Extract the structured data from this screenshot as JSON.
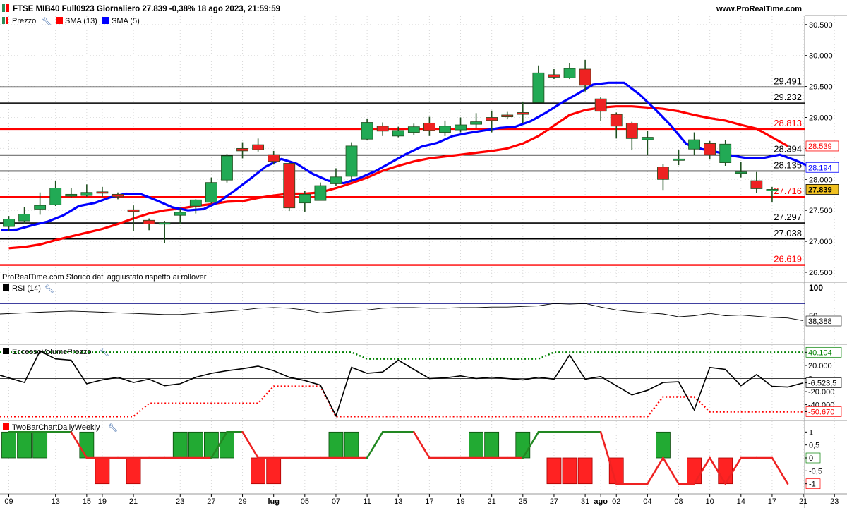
{
  "header": {
    "title": "FTSE MIB40 Full0923 Giornaliero 27.839 -0,38% 18 ago 2023, 21:59:59",
    "site": "www.ProRealTime.com"
  },
  "legend": [
    {
      "label": "Prezzo",
      "color": "#2e8b57"
    },
    {
      "label": "SMA (13)",
      "color": "#ff0000"
    },
    {
      "label": "SMA (5)",
      "color": "#0000ff"
    }
  ],
  "footnote": "ProRealTime.com Storico dati aggiustato rispetto ai rollover",
  "panels": {
    "rsi": {
      "title": "RSI (14)",
      "value_label": "38,388",
      "levels": [
        "100",
        "50"
      ]
    },
    "eccesso": {
      "title": "EccessoVolumePrezzo",
      "upper_label": "40.104",
      "value_label": "-6.523,5",
      "lower_label": "-50.670"
    },
    "twobar": {
      "title": "TwoBarChartDailyWeekly"
    }
  },
  "chart_data": [
    {
      "type": "candlestick",
      "name": "price",
      "ylim": [
        26500,
        30600
      ],
      "yticks": [
        {
          "v": 30500,
          "label": "30.500"
        },
        {
          "v": 30000,
          "label": "30.000"
        },
        {
          "v": 29500,
          "label": "29.500"
        },
        {
          "v": 29000,
          "label": "29.000"
        },
        {
          "v": 28500,
          "label": ""
        },
        {
          "v": 28000,
          "label": "28.000"
        },
        {
          "v": 27500,
          "label": "27.500"
        },
        {
          "v": 27000,
          "label": "27.000"
        },
        {
          "v": 26500,
          "label": "26.500"
        }
      ],
      "x_labels": [
        {
          "i": 0,
          "label": "09"
        },
        {
          "i": 3,
          "label": "13"
        },
        {
          "i": 5,
          "label": "15"
        },
        {
          "i": 6,
          "label": "19"
        },
        {
          "i": 8,
          "label": "21"
        },
        {
          "i": 11,
          "label": "23"
        },
        {
          "i": 13,
          "label": "27"
        },
        {
          "i": 15,
          "label": "29"
        },
        {
          "i": 17,
          "label": "lug"
        },
        {
          "i": 19,
          "label": "05"
        },
        {
          "i": 21,
          "label": "07"
        },
        {
          "i": 23,
          "label": "11"
        },
        {
          "i": 25,
          "label": "13"
        },
        {
          "i": 27,
          "label": "17"
        },
        {
          "i": 29,
          "label": "19"
        },
        {
          "i": 31,
          "label": "21"
        },
        {
          "i": 33,
          "label": "25"
        },
        {
          "i": 35,
          "label": "27"
        },
        {
          "i": 37,
          "label": "31"
        },
        {
          "i": 38,
          "label": "ago"
        },
        {
          "i": 39,
          "label": "02"
        },
        {
          "i": 41,
          "label": "04"
        },
        {
          "i": 43,
          "label": "08"
        },
        {
          "i": 45,
          "label": "10"
        },
        {
          "i": 47,
          "label": "14"
        },
        {
          "i": 49,
          "label": "17"
        },
        {
          "i": 51,
          "label": "21"
        },
        {
          "i": 53,
          "label": "23"
        }
      ],
      "candles": [
        {
          "o": 27240,
          "h": 27410,
          "l": 27170,
          "c": 27360
        },
        {
          "o": 27330,
          "h": 27550,
          "l": 27290,
          "c": 27440
        },
        {
          "o": 27520,
          "h": 27790,
          "l": 27430,
          "c": 27580
        },
        {
          "o": 27590,
          "h": 27970,
          "l": 27570,
          "c": 27860
        },
        {
          "o": 27730,
          "h": 27860,
          "l": 27710,
          "c": 27760
        },
        {
          "o": 27740,
          "h": 27920,
          "l": 27720,
          "c": 27790
        },
        {
          "o": 27800,
          "h": 27880,
          "l": 27720,
          "c": 27780
        },
        {
          "o": 27760,
          "h": 27790,
          "l": 27680,
          "c": 27720
        },
        {
          "o": 27510,
          "h": 27580,
          "l": 27170,
          "c": 27480
        },
        {
          "o": 27340,
          "h": 27370,
          "l": 27180,
          "c": 27280
        },
        {
          "o": 27280,
          "h": 27330,
          "l": 26970,
          "c": 27300
        },
        {
          "o": 27420,
          "h": 27530,
          "l": 27280,
          "c": 27470
        },
        {
          "o": 27570,
          "h": 27680,
          "l": 27450,
          "c": 27670
        },
        {
          "o": 27630,
          "h": 28030,
          "l": 27610,
          "c": 27950
        },
        {
          "o": 27990,
          "h": 28410,
          "l": 27950,
          "c": 28380
        },
        {
          "o": 28500,
          "h": 28600,
          "l": 28340,
          "c": 28460
        },
        {
          "o": 28560,
          "h": 28660,
          "l": 28450,
          "c": 28480
        },
        {
          "o": 28400,
          "h": 28460,
          "l": 28240,
          "c": 28290
        },
        {
          "o": 28260,
          "h": 28290,
          "l": 27490,
          "c": 27540
        },
        {
          "o": 27620,
          "h": 27820,
          "l": 27480,
          "c": 27760
        },
        {
          "o": 27660,
          "h": 27950,
          "l": 27660,
          "c": 27900
        },
        {
          "o": 27930,
          "h": 28180,
          "l": 27900,
          "c": 28040
        },
        {
          "o": 28050,
          "h": 28600,
          "l": 27960,
          "c": 28540
        },
        {
          "o": 28650,
          "h": 28980,
          "l": 28640,
          "c": 28920
        },
        {
          "o": 28860,
          "h": 28920,
          "l": 28700,
          "c": 28780
        },
        {
          "o": 28700,
          "h": 28850,
          "l": 28680,
          "c": 28790
        },
        {
          "o": 28760,
          "h": 28900,
          "l": 28710,
          "c": 28850
        },
        {
          "o": 28910,
          "h": 29010,
          "l": 28700,
          "c": 28790
        },
        {
          "o": 28760,
          "h": 28950,
          "l": 28700,
          "c": 28860
        },
        {
          "o": 28800,
          "h": 29000,
          "l": 28760,
          "c": 28880
        },
        {
          "o": 28890,
          "h": 29070,
          "l": 28830,
          "c": 28930
        },
        {
          "o": 29000,
          "h": 29110,
          "l": 28760,
          "c": 28950
        },
        {
          "o": 29040,
          "h": 29090,
          "l": 28970,
          "c": 29010
        },
        {
          "o": 29080,
          "h": 29250,
          "l": 28910,
          "c": 29050
        },
        {
          "o": 29240,
          "h": 29840,
          "l": 29240,
          "c": 29720
        },
        {
          "o": 29690,
          "h": 29780,
          "l": 29620,
          "c": 29650
        },
        {
          "o": 29640,
          "h": 29880,
          "l": 29620,
          "c": 29790
        },
        {
          "o": 29780,
          "h": 29930,
          "l": 29420,
          "c": 29520
        },
        {
          "o": 29300,
          "h": 29330,
          "l": 28940,
          "c": 29100
        },
        {
          "o": 29050,
          "h": 29080,
          "l": 28660,
          "c": 28860
        },
        {
          "o": 28910,
          "h": 28930,
          "l": 28470,
          "c": 28660
        },
        {
          "o": 28640,
          "h": 28780,
          "l": 28400,
          "c": 28680
        },
        {
          "o": 28200,
          "h": 28250,
          "l": 27830,
          "c": 28000
        },
        {
          "o": 28310,
          "h": 28470,
          "l": 28230,
          "c": 28330
        },
        {
          "o": 28490,
          "h": 28760,
          "l": 28390,
          "c": 28640
        },
        {
          "o": 28580,
          "h": 28620,
          "l": 28320,
          "c": 28400
        },
        {
          "o": 28270,
          "h": 28640,
          "l": 28220,
          "c": 28570
        },
        {
          "o": 28100,
          "h": 28280,
          "l": 28030,
          "c": 28120
        },
        {
          "o": 27980,
          "h": 28120,
          "l": 27780,
          "c": 27850
        },
        {
          "o": 27830,
          "h": 27880,
          "l": 27630,
          "c": 27839
        }
      ],
      "sma5": [
        27180,
        27190,
        27260,
        27320,
        27420,
        27570,
        27620,
        27710,
        27770,
        27760,
        27660,
        27550,
        27500,
        27520,
        27640,
        27820,
        28010,
        28210,
        28330,
        28250,
        28090,
        27980,
        27940,
        28020,
        28130,
        28270,
        28410,
        28530,
        28590,
        28700,
        28750,
        28790,
        28830,
        28850,
        28940,
        29080,
        29240,
        29380,
        29530,
        29560,
        29560,
        29370,
        29130,
        28870,
        28570,
        28490,
        28440,
        28380,
        28340,
        28350,
        28400,
        28310,
        28194
      ],
      "sma13": [
        26890,
        26910,
        26950,
        27020,
        27080,
        27140,
        27200,
        27280,
        27370,
        27450,
        27500,
        27530,
        27570,
        27600,
        27640,
        27650,
        27700,
        27740,
        27770,
        27770,
        27790,
        27860,
        27940,
        28030,
        28140,
        28220,
        28290,
        28340,
        28370,
        28400,
        28430,
        28460,
        28500,
        28580,
        28700,
        28870,
        29040,
        29120,
        29160,
        29180,
        29180,
        29160,
        29140,
        29100,
        29040,
        28990,
        28950,
        28880,
        28820,
        28680,
        28539
      ],
      "hlines": [
        {
          "v": 29491,
          "label": "29.491",
          "color": "#000000"
        },
        {
          "v": 29232,
          "label": "29.232",
          "color": "#000000"
        },
        {
          "v": 28813,
          "label": "28.813",
          "color": "#ff0000"
        },
        {
          "v": 28394,
          "label": "28.394",
          "color": "#000000"
        },
        {
          "v": 28135,
          "label": "28.135",
          "color": "#000000"
        },
        {
          "v": 27716,
          "label": "27.716",
          "color": "#ff0000"
        },
        {
          "v": 27297,
          "label": "27.297",
          "color": "#000000"
        },
        {
          "v": 27038,
          "label": "27.038",
          "color": "#000000"
        },
        {
          "v": 26619,
          "label": "26.619",
          "color": "#ff0000"
        }
      ],
      "badges": [
        {
          "v": 28539,
          "label": "28.539",
          "color": "#ff0000",
          "bg": "#ffffff"
        },
        {
          "v": 28194,
          "label": "28.194",
          "color": "#0000ff",
          "bg": "#ffffff"
        },
        {
          "v": 27839,
          "label": "27.839",
          "color": "#000000",
          "bg": "#f0c020"
        }
      ]
    },
    {
      "type": "line",
      "name": "rsi",
      "ylim": [
        0,
        100
      ],
      "levels": [
        70,
        50,
        30
      ],
      "values": [
        50,
        52,
        53,
        54,
        55,
        54,
        53,
        52,
        51,
        50,
        49,
        49,
        51,
        53,
        55,
        57,
        60,
        61,
        60,
        57,
        52,
        54,
        56,
        57,
        60,
        61,
        61,
        60,
        60,
        61,
        61,
        62,
        62,
        63,
        64,
        68,
        67,
        68,
        62,
        57,
        54,
        52,
        50,
        45,
        47,
        51,
        47,
        48,
        46,
        44,
        43,
        38.388
      ]
    },
    {
      "type": "line",
      "name": "eccesso",
      "ylim": [
        -62000,
        48000
      ],
      "yticks": [
        {
          "v": 40104,
          "label": "40.104",
          "color": "#008000"
        },
        {
          "v": 20000,
          "label": "20.000",
          "color": "#000000"
        },
        {
          "v": 0,
          "label": "0",
          "color": "#000000"
        },
        {
          "v": -6523.5,
          "label": "-6.523,5",
          "color": "#000000"
        },
        {
          "v": -20000,
          "label": "-20.000",
          "color": "#000000"
        },
        {
          "v": -40000,
          "label": "-40.000",
          "color": "#000000"
        },
        {
          "v": -50670,
          "label": "-50.670",
          "color": "#ff0000"
        }
      ],
      "values": [
        5000,
        -6000,
        42000,
        30000,
        28000,
        -8000,
        -2000,
        2000,
        -6000,
        -1000,
        -11000,
        -8000,
        2000,
        8000,
        12000,
        15000,
        19000,
        12000,
        2000,
        -3000,
        -10000,
        -57000,
        17000,
        8000,
        10000,
        28000,
        14000,
        0,
        1000,
        4000,
        0,
        2000,
        0,
        -2000,
        2000,
        -1000,
        36000,
        -1000,
        3000,
        -11000,
        -25000,
        -18000,
        -6000,
        -5000,
        -48000,
        17000,
        14000,
        -11000,
        6000,
        -12000,
        -13000,
        -6523.5
      ],
      "upper": [
        40104,
        40104,
        40104,
        40104,
        40104,
        40104,
        40104,
        40104,
        40104,
        40104,
        40104,
        40104,
        40104,
        40104,
        40104,
        40104,
        40104,
        40104,
        40104,
        40104,
        40104,
        40104,
        40104,
        30000,
        30000,
        30000,
        30000,
        30000,
        30000,
        30000,
        30000,
        30000,
        30000,
        30000,
        30000,
        40104,
        40104,
        40104,
        40104,
        40104,
        40104,
        40104,
        40104,
        40104,
        40104,
        40104,
        40104,
        40104,
        40104,
        40104,
        40104,
        40104
      ],
      "lower": [
        -58000,
        -58000,
        -58000,
        -58000,
        -58000,
        -58000,
        -58000,
        -58000,
        -58000,
        -38000,
        -38000,
        -38000,
        -38000,
        -38000,
        -38000,
        -38000,
        -38000,
        -12000,
        -12000,
        -12000,
        -12000,
        -58000,
        -58000,
        -58000,
        -58000,
        -58000,
        -58000,
        -58000,
        -58000,
        -58000,
        -58000,
        -58000,
        -58000,
        -58000,
        -58000,
        -58000,
        -58000,
        -58000,
        -58000,
        -58000,
        -58000,
        -58000,
        -28000,
        -28000,
        -28000,
        -50670,
        -50670,
        -50670,
        -50670,
        -50670,
        -50670,
        -50670
      ]
    },
    {
      "type": "bar",
      "name": "twobar",
      "ylim": [
        -1.2,
        1.2
      ],
      "yticks": [
        {
          "v": 1,
          "label": "1"
        },
        {
          "v": 0.5,
          "label": "0,5"
        },
        {
          "v": 0,
          "label": "0"
        },
        {
          "v": -0.5,
          "label": "-0,5"
        },
        {
          "v": -1,
          "label": "-1"
        }
      ],
      "bars": [
        1,
        1,
        1,
        0,
        0,
        1,
        -1,
        0,
        -1,
        0,
        0,
        1,
        1,
        1,
        1,
        0,
        -1,
        -1,
        0,
        0,
        0,
        1,
        1,
        0,
        0,
        0,
        0,
        0,
        0,
        0,
        1,
        1,
        0,
        1,
        0,
        -1,
        -1,
        -1,
        0,
        -1,
        0,
        0,
        1,
        0,
        -1,
        0,
        -1,
        0,
        0,
        0,
        0
      ],
      "line": [
        1,
        1,
        1,
        1,
        1,
        0,
        0,
        0,
        0,
        0,
        0,
        0,
        0,
        0,
        1,
        1,
        0,
        0,
        0,
        0,
        0,
        0,
        0,
        0,
        1,
        1,
        1,
        0,
        0,
        0,
        0,
        0,
        0,
        0,
        1,
        1,
        1,
        1,
        1,
        -1,
        -1,
        -1,
        0,
        -1,
        -1,
        0,
        -1,
        0,
        0,
        0,
        -1
      ]
    }
  ]
}
